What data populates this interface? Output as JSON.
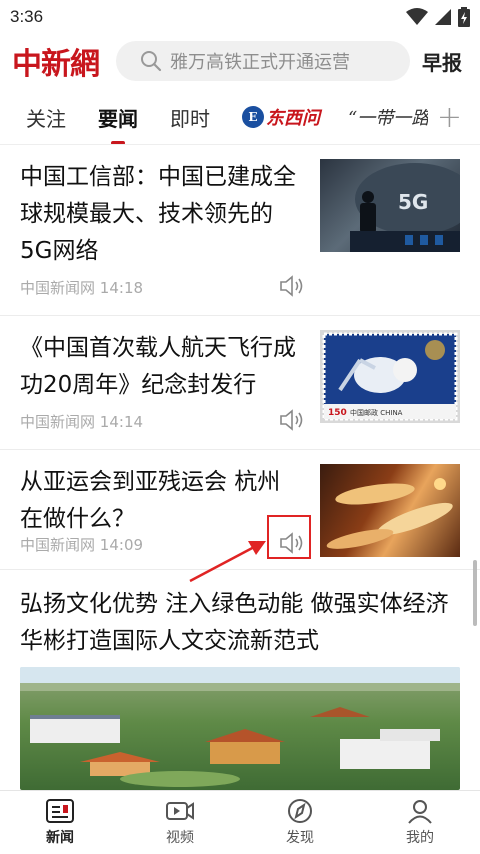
{
  "status": {
    "time": "3:36"
  },
  "header": {
    "logo": "中新網",
    "search_placeholder": "雅万高铁正式开通运营",
    "morning_label": "早报"
  },
  "tabs": [
    {
      "label": "关注"
    },
    {
      "label": "要闻",
      "active": true
    },
    {
      "label": "即时"
    },
    {
      "label": "东西问"
    },
    {
      "label": "“一带一路"
    }
  ],
  "articles": [
    {
      "title": "中国工信部：中国已建成全球规模最大、技术领先的5G网络",
      "source": "中国新闻网",
      "time": "14:18"
    },
    {
      "title": "《中国首次载人航天飞行成功20周年》纪念封发行",
      "source": "中国新闻网",
      "time": "14:14"
    },
    {
      "title": "从亚运会到亚残运会 杭州在做什么？",
      "source": "中国新闻网",
      "time": "14:09"
    },
    {
      "title": "弘扬文化优势 注入绿色动能 做强实体经济 华彬打造国际人文交流新范式"
    }
  ],
  "thumb_text": {
    "fiveg": "5G",
    "stamp_price": "150",
    "stamp_label": "中国邮政 CHINA"
  },
  "bottom_nav": [
    {
      "label": "新闻",
      "icon": "news-icon",
      "active": true
    },
    {
      "label": "视频",
      "icon": "video-icon"
    },
    {
      "label": "发现",
      "icon": "discover-icon"
    },
    {
      "label": "我的",
      "icon": "profile-icon"
    }
  ],
  "colors": {
    "brand": "#c8161d",
    "annotation": "#e02424"
  }
}
